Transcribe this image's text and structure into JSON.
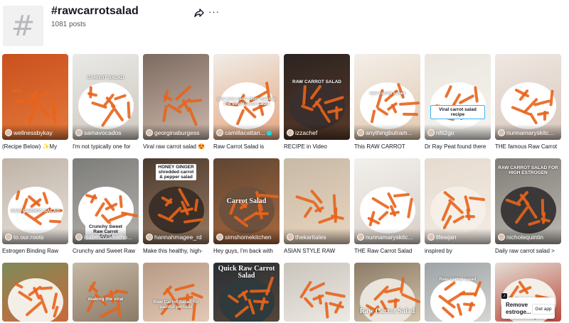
{
  "header": {
    "hashtag_symbol": "#",
    "title": "#rawcarrotsalad",
    "post_count": "1081 posts",
    "share_icon": "share-arrow-icon",
    "more_label": "···"
  },
  "colors": {
    "text": "#161823",
    "muted": "#57585f",
    "carrot": "#e8641c",
    "verified": "#20d5ec"
  },
  "videos": [
    {
      "username": "wellnessbykay",
      "caption": "(Recipe Below) ✨My",
      "overlay": ""
    },
    {
      "username": "samavocados",
      "caption": "I'm not typically one for",
      "overlay": "CARROT SALAD"
    },
    {
      "username": "georginaburgess",
      "caption": "Viral raw carrot salad 😍",
      "overlay": ""
    },
    {
      "username": "camillacattan...",
      "verified": true,
      "caption": "Raw Carrot Salad is",
      "overlay": "pov you can't stop making the viral carrot salad"
    },
    {
      "username": "izzachef",
      "caption": "RECIPE in Video",
      "overlay": "RAW CARROT SALAD"
    },
    {
      "username": "anythingbutram...",
      "caption": "This RAW CARROT",
      "overlay": "raw carrot salad"
    },
    {
      "username": "nfit2go",
      "caption": "Dr Ray Peat found there",
      "overlay": "Viral carrot salad recipe"
    },
    {
      "username": "nunnamaryskitc...",
      "caption": "THE famous Raw Carrot",
      "overlay": ""
    },
    {
      "username": "to.our.roots",
      "caption": "Estrogen Binding Raw",
      "overlay": "RAW CARROT SALAD"
    },
    {
      "username": "isabelcooksatho...",
      "caption": "Crunchy and Sweet Raw",
      "overlay": "Crunchy Sweet Raw Carrot Salad"
    },
    {
      "username": "hannahmagee_rd",
      "caption": "Make this healthy, high-",
      "overlay": "HONEY GINGER shredded carrot & pepper salad"
    },
    {
      "username": "simshomekitchen",
      "caption": "Hey guys, I'm back with",
      "overlay": "Carrot Salad"
    },
    {
      "username": "thekaritales",
      "caption": "ASIAN STYLE RAW",
      "overlay": ""
    },
    {
      "username": "nunnamaryskitc...",
      "caption": "THE Raw Carrot Salad",
      "overlay": ""
    },
    {
      "username": "lifewjan",
      "caption": "inspired by",
      "overlay": ""
    },
    {
      "username": "nicholequintin",
      "caption": "Daily raw carrot salad >",
      "overlay": "RAW CARROT SALAD FOR HIGH ESTROGEN"
    },
    {
      "username": "",
      "caption": "",
      "overlay": ""
    },
    {
      "username": "",
      "caption": "",
      "overlay": "making the viral"
    },
    {
      "username": "",
      "caption": "",
      "overlay": "Raw Carrot Salad for painful periods"
    },
    {
      "username": "",
      "caption": "",
      "overlay": "Quick Raw Carrot Salad"
    },
    {
      "username": "",
      "caption": "",
      "overlay": ""
    },
    {
      "username": "",
      "caption": "",
      "overlay": "Raw Carrot Salad"
    },
    {
      "username": "",
      "caption": "",
      "overlay": "Raw carrot salad"
    },
    {
      "username": "",
      "caption": "",
      "overlay": ""
    }
  ],
  "get_app": {
    "message": "Remove estroge...",
    "button": "Get app",
    "logo": "♪"
  }
}
